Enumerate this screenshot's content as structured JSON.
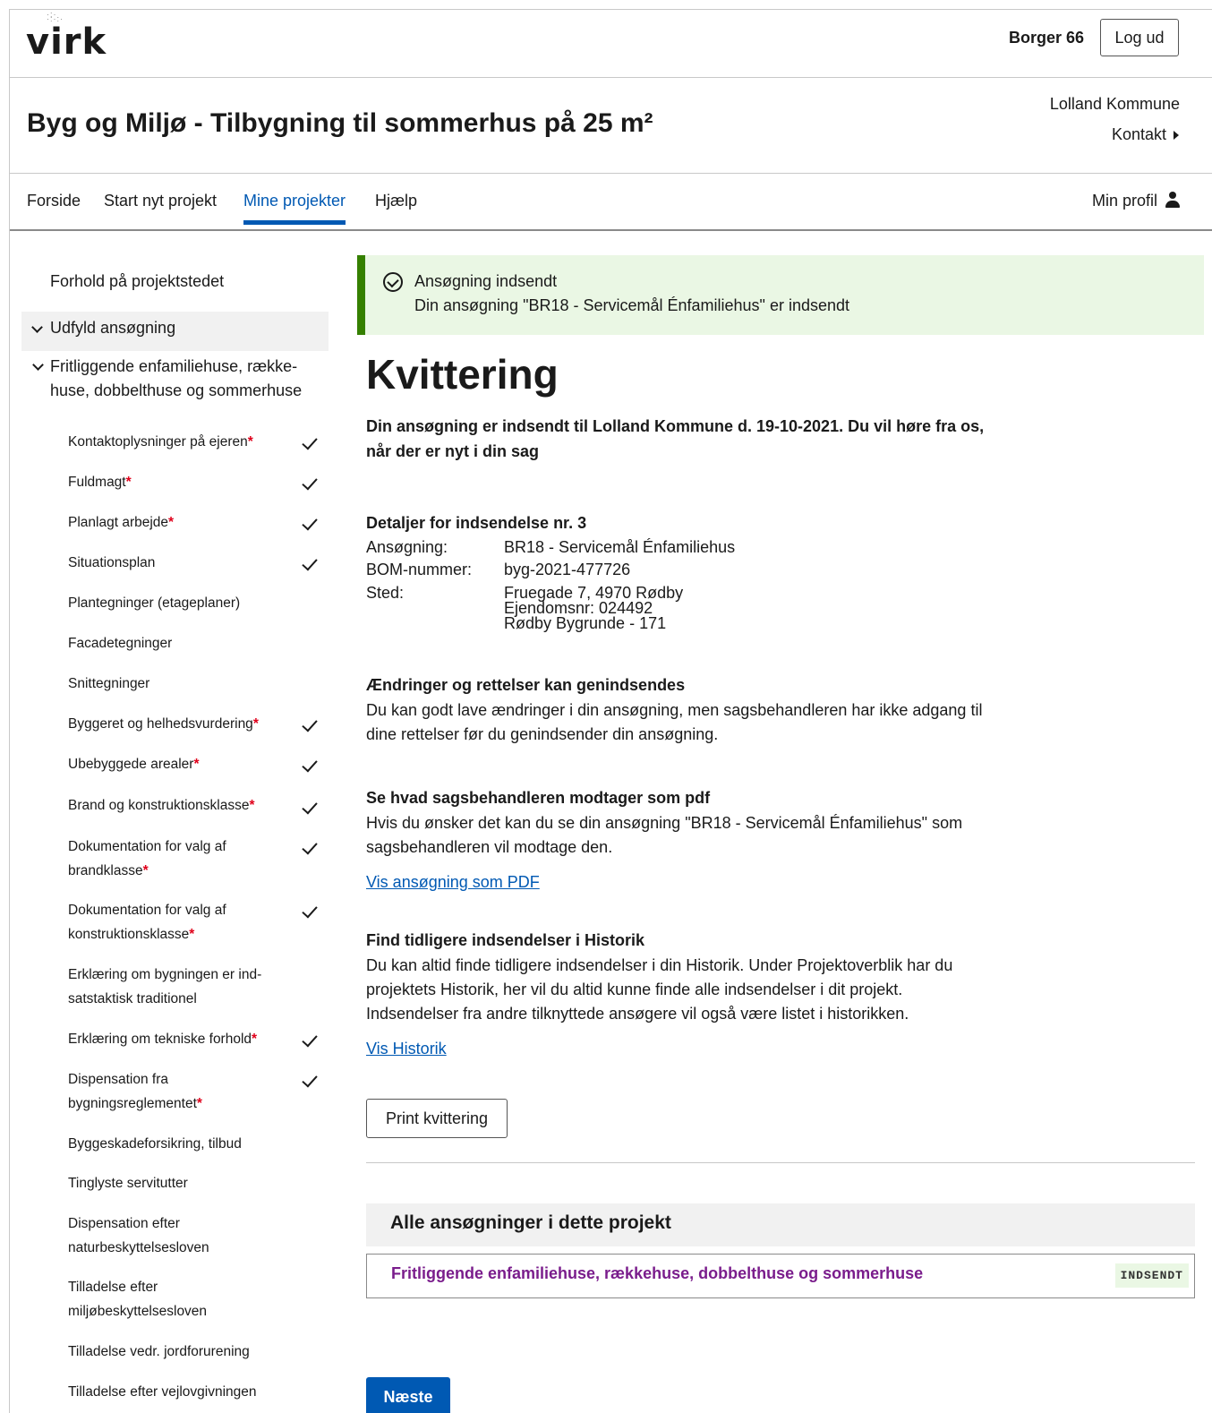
{
  "header": {
    "logo": "virk",
    "user_name": "Borger 66",
    "logout_label": "Log ud"
  },
  "titlebar": {
    "title": "Byg og Miljø - Tilbygning til sommerhus på 25 m²",
    "municipality": "Lolland Kommune",
    "contact_label": "Kontakt"
  },
  "nav": {
    "items": [
      {
        "label": "Forside"
      },
      {
        "label": "Start nyt projekt"
      },
      {
        "label": "Mine projekter"
      },
      {
        "label": "Hjælp"
      }
    ],
    "profile_label": "Min profil"
  },
  "sidebar": {
    "top_item": "Forhold på projektstedet",
    "group_label": "Udfyld ansøgning",
    "sub_group_label": "Fritliggende enfamiliehuse, række-huse, dobbelthuse og sommerhuse",
    "required_mark": "*",
    "steps": [
      {
        "label": "Kontaktoplysninger på ejeren",
        "required": true,
        "done": true
      },
      {
        "label": "Fuldmagt",
        "required": true,
        "done": true
      },
      {
        "label": "Planlagt arbejde",
        "required": true,
        "done": true
      },
      {
        "label": "Situationsplan",
        "required": false,
        "done": true
      },
      {
        "label": "Plantegninger (etageplaner)",
        "required": false,
        "done": false
      },
      {
        "label": "Facadetegninger",
        "required": false,
        "done": false
      },
      {
        "label": "Snittegninger",
        "required": false,
        "done": false
      },
      {
        "label": "Byggeret og helhedsvurdering",
        "required": true,
        "done": true
      },
      {
        "label": "Ubebyggede arealer",
        "required": true,
        "done": true
      },
      {
        "label": "Brand og konstruktionsklasse",
        "required": true,
        "done": true
      },
      {
        "label": "Dokumentation for valg af brandklasse",
        "required": true,
        "done": true
      },
      {
        "label": "Dokumentation for valg af konstruktionsklasse",
        "required": true,
        "done": true
      },
      {
        "label": "Erklæring om bygningen er ind-satstaktisk traditionel",
        "required": false,
        "done": false
      },
      {
        "label": "Erklæring om tekniske forhold",
        "required": true,
        "done": true
      },
      {
        "label": "Dispensation fra bygningsreglementet",
        "required": true,
        "done": true
      },
      {
        "label": "Byggeskadeforsikring, tilbud",
        "required": false,
        "done": false
      },
      {
        "label": "Tinglyste servitutter",
        "required": false,
        "done": false
      },
      {
        "label": "Dispensation efter naturbeskyttelsesloven",
        "required": false,
        "done": false
      },
      {
        "label": "Tilladelse efter miljøbeskyttelsesloven",
        "required": false,
        "done": false
      },
      {
        "label": "Tilladelse vedr. jordforurening",
        "required": false,
        "done": false
      },
      {
        "label": "Tilladelse efter vejlovgivningen",
        "required": false,
        "done": false
      }
    ]
  },
  "alert": {
    "title": "Ansøgning indsendt",
    "text": "Din ansøgning \"BR18 - Servicemål Énfamiliehus\" er indsendt"
  },
  "receipt": {
    "heading": "Kvittering",
    "lead": "Din ansøgning er indsendt til Lolland Kommune d. 19-10-2021. Du vil høre fra os, når der er nyt i din sag",
    "details_title": "Detaljer for indsendelse nr. 3",
    "details": {
      "application_label": "Ansøgning:",
      "application_value": "BR18 - Servicemål Énfamiliehus",
      "bom_label": "BOM-nummer:",
      "bom_value": "byg-2021-477726",
      "place_label": "Sted:",
      "place_line1": "Fruegade 7, 4970 Rødby",
      "place_line2": "Ejendomsnr: 024492",
      "place_line3": "Rødby Bygrunde - 171"
    },
    "changes_title": "Ændringer og rettelser kan genindsendes",
    "changes_text": "Du kan godt lave ændringer i din ansøgning, men sagsbehandleren har ikke adgang til dine rettelser før du genindsender din ansøgning.",
    "pdf_title": "Se hvad sagsbehandleren modtager som pdf",
    "pdf_text": "Hvis du ønsker det kan du se din ansøgning \"BR18 - Servicemål Énfamiliehus\" som sagsbehandleren vil modtage den.",
    "pdf_link": "Vis ansøgning som PDF",
    "history_title": "Find tidligere indsendelser i Historik",
    "history_text": "Du kan altid finde tidligere indsendelser i din Historik. Under Projektoverblik har du projektets Historik, her vil du altid kunne finde alle indsendelser i dit projekt. Indsendelser fra andre tilknyttede ansøgere vil også være listet i historikken.",
    "history_link": "Vis Historik",
    "print_label": "Print kvittering"
  },
  "projects": {
    "heading": "Alle ansøgninger i dette projekt",
    "items": [
      {
        "name": "Fritliggende enfamiliehuse, rækkehuse, dobbelthuse og sommerhuse",
        "status": "INDSENDT"
      }
    ]
  },
  "next_label": "Næste",
  "colors": {
    "primary": "#0059b3",
    "success_bg": "#eaf7e4",
    "success_border": "#358000",
    "required": "#e0001b",
    "project_link": "#7a1d8c"
  }
}
